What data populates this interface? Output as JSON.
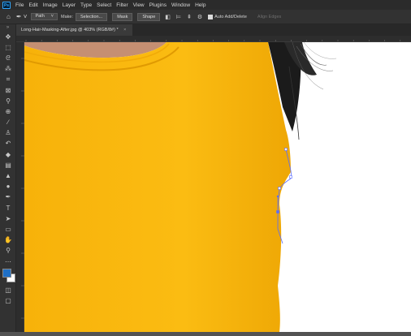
{
  "app": {
    "logo_text": "Ps"
  },
  "menu": [
    "File",
    "Edit",
    "Image",
    "Layer",
    "Type",
    "Select",
    "Filter",
    "View",
    "Plugins",
    "Window",
    "Help"
  ],
  "options": {
    "mode_value": "Path",
    "make_label": "Make:",
    "selection_btn": "Selection...",
    "mask_btn": "Mask",
    "shape_btn": "Shape",
    "auto_add_delete_label": "Auto Add/Delete",
    "align_edges_label": "Align Edges"
  },
  "document": {
    "tab_title": "Long-Hair-Masking-After.jpg @ 403% (RGB/8#) *"
  },
  "rulers": {
    "top_ticks": [
      "270",
      "300",
      "325",
      "350",
      "375",
      "400",
      "425",
      "450",
      "475",
      "500",
      "525",
      "550",
      "575",
      "600",
      "625",
      "650",
      "675",
      "700",
      "725",
      "750",
      "775",
      "800",
      "825",
      "850",
      "875"
    ]
  },
  "colors": {
    "shirt": "#f9b90d",
    "shirt_shadow": "#eaa304",
    "skin": "#c58f72",
    "hair": "#1b1b1b",
    "path_stroke": "#5a6cff",
    "foreground": "#1f6fc5",
    "background": "#ffffff"
  },
  "tools": [
    "move-icon",
    "marquee-icon",
    "lasso-icon",
    "magic-wand-icon",
    "crop-icon",
    "frame-icon",
    "eyedropper-icon",
    "healing-brush-icon",
    "brush-icon",
    "clone-stamp-icon",
    "history-brush-icon",
    "eraser-icon",
    "gradient-icon",
    "blur-icon",
    "dodge-icon",
    "pen-icon",
    "type-icon",
    "path-selection-icon",
    "rectangle-icon",
    "hand-icon",
    "zoom-icon",
    "more-tools-icon"
  ]
}
